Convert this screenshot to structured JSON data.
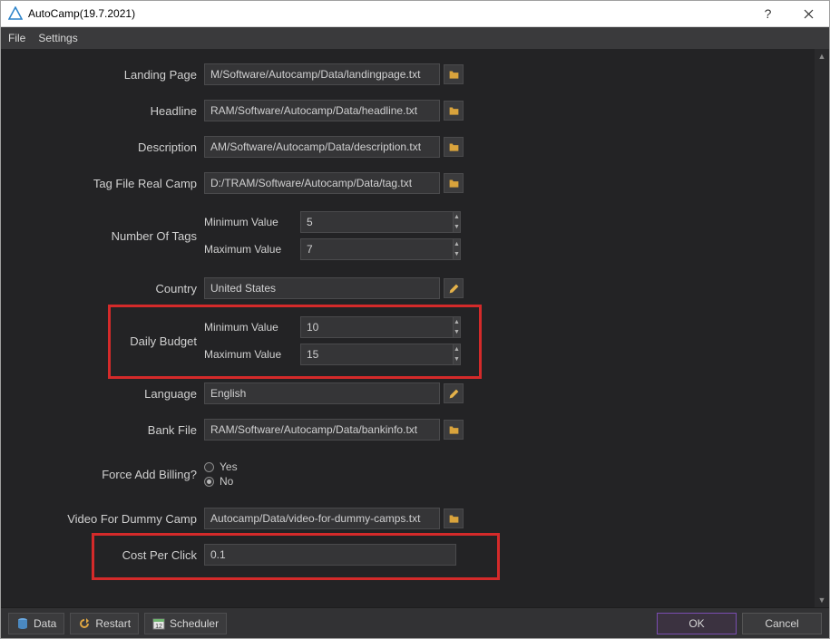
{
  "window": {
    "title": "AutoCamp(19.7.2021)"
  },
  "menu": {
    "file": "File",
    "settings": "Settings"
  },
  "form": {
    "landing_page": {
      "label": "Landing Page",
      "value": "M/Software/Autocamp/Data/landingpage.txt"
    },
    "headline": {
      "label": "Headline",
      "value": "RAM/Software/Autocamp/Data/headline.txt"
    },
    "description": {
      "label": "Description",
      "value": "AM/Software/Autocamp/Data/description.txt"
    },
    "tag_file": {
      "label": "Tag File Real Camp",
      "value": "D:/TRAM/Software/Autocamp/Data/tag.txt"
    },
    "num_tags": {
      "label": "Number Of Tags",
      "min_label": "Minimum Value",
      "max_label": "Maximum Value",
      "min_value": "5",
      "max_value": "7"
    },
    "country": {
      "label": "Country",
      "value": "United States"
    },
    "daily_budget": {
      "label": "Daily Budget",
      "min_label": "Minimum Value",
      "max_label": "Maximum Value",
      "min_value": "10",
      "max_value": "15"
    },
    "language": {
      "label": "Language",
      "value": "English"
    },
    "bank_file": {
      "label": "Bank File",
      "value": "RAM/Software/Autocamp/Data/bankinfo.txt"
    },
    "force_add_billing": {
      "label": "Force Add Billing?",
      "yes": "Yes",
      "no": "No",
      "selected": "no"
    },
    "video_dummy": {
      "label": "Video For Dummy Camp",
      "value": "Autocamp/Data/video-for-dummy-camps.txt"
    },
    "cpc": {
      "label": "Cost Per Click",
      "value": "0.1"
    }
  },
  "footer": {
    "data": "Data",
    "restart": "Restart",
    "scheduler": "Scheduler",
    "ok": "OK",
    "cancel": "Cancel"
  }
}
